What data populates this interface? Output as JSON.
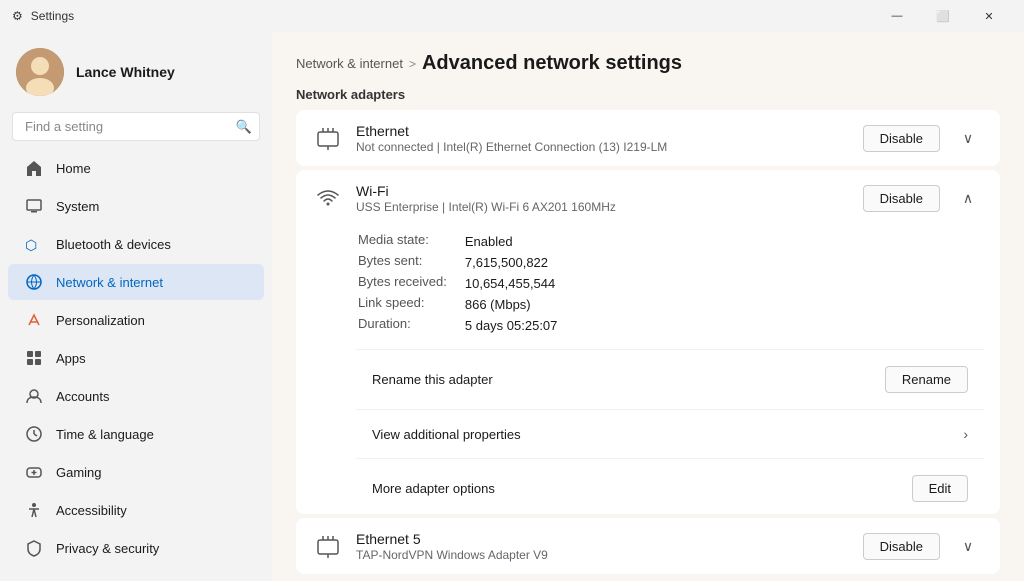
{
  "titleBar": {
    "title": "Settings",
    "controls": {
      "minimize": "—",
      "maximize": "⬜",
      "close": "✕"
    }
  },
  "sidebar": {
    "user": {
      "name": "Lance Whitney",
      "avatarText": "👤"
    },
    "search": {
      "placeholder": "Find a setting"
    },
    "navItems": [
      {
        "id": "home",
        "label": "Home",
        "icon": "🏠"
      },
      {
        "id": "system",
        "label": "System",
        "icon": "🖥"
      },
      {
        "id": "bluetooth",
        "label": "Bluetooth & devices",
        "icon": "🔵"
      },
      {
        "id": "network",
        "label": "Network & internet",
        "icon": "🌐",
        "active": true
      },
      {
        "id": "personalization",
        "label": "Personalization",
        "icon": "✏️"
      },
      {
        "id": "apps",
        "label": "Apps",
        "icon": "📦"
      },
      {
        "id": "accounts",
        "label": "Accounts",
        "icon": "👤"
      },
      {
        "id": "time",
        "label": "Time & language",
        "icon": "🕐"
      },
      {
        "id": "gaming",
        "label": "Gaming",
        "icon": "🎮"
      },
      {
        "id": "accessibility",
        "label": "Accessibility",
        "icon": "♿"
      },
      {
        "id": "privacy",
        "label": "Privacy & security",
        "icon": "🔒"
      }
    ]
  },
  "main": {
    "breadcrumb": {
      "parent": "Network & internet",
      "separator": ">",
      "current": "Advanced network settings"
    },
    "sectionTitle": "Network adapters",
    "adapters": [
      {
        "id": "ethernet",
        "name": "Ethernet",
        "desc": "Not connected | Intel(R) Ethernet Connection (13) I219-LM",
        "icon": "🖧",
        "btnLabel": "Disable",
        "expanded": false,
        "expandIcon": "∨"
      },
      {
        "id": "wifi",
        "name": "Wi-Fi",
        "desc": "USS Enterprise | Intel(R) Wi-Fi 6 AX201 160MHz",
        "icon": "📶",
        "btnLabel": "Disable",
        "expanded": true,
        "expandIcon": "∧"
      }
    ],
    "wifiDetails": {
      "mediaState": {
        "label": "Media state:",
        "value": "Enabled"
      },
      "bytesSent": {
        "label": "Bytes sent:",
        "value": "7,615,500,822"
      },
      "bytesReceived": {
        "label": "Bytes received:",
        "value": "10,654,455,544"
      },
      "linkSpeed": {
        "label": "Link speed:",
        "value": "866 (Mbps)"
      },
      "duration": {
        "label": "Duration:",
        "value": "5 days 05:25:07"
      }
    },
    "actions": {
      "rename": {
        "label": "Rename this adapter",
        "btnLabel": "Rename"
      },
      "viewProperties": {
        "label": "View additional properties"
      },
      "moreOptions": {
        "label": "More adapter options",
        "btnLabel": "Edit"
      }
    },
    "ethernet5": {
      "name": "Ethernet 5",
      "desc": "TAP-NordVPN Windows Adapter V9",
      "btnLabel": "Disable",
      "expandIcon": "∨"
    }
  }
}
